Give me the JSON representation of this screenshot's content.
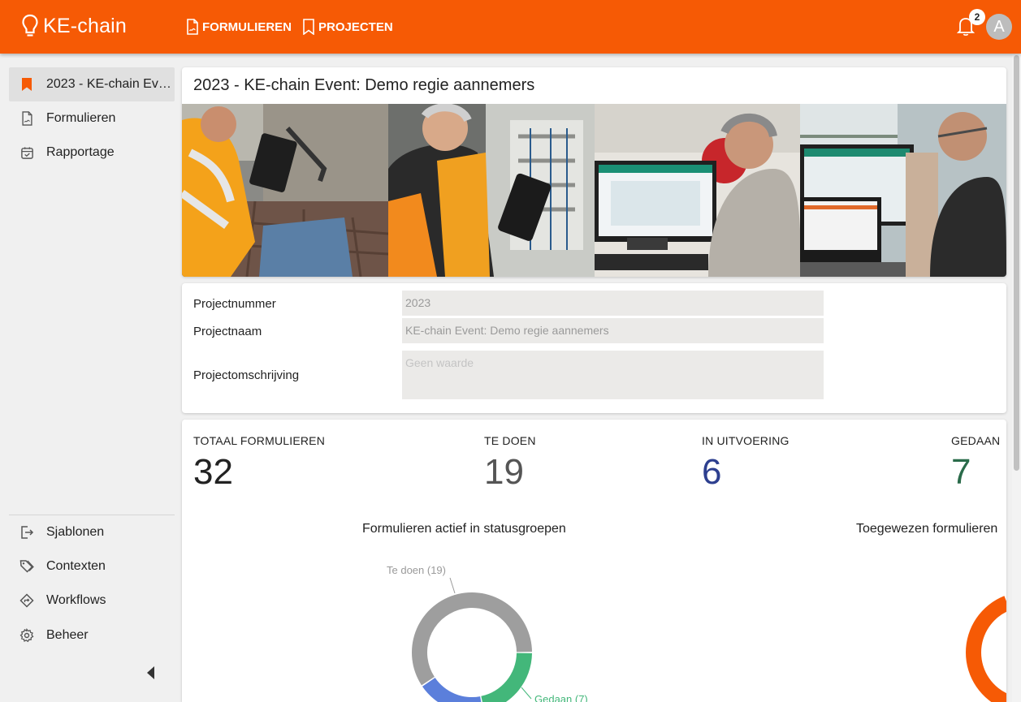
{
  "header": {
    "logo_text": "KE-chain",
    "nav": [
      {
        "label": "FORMULIEREN"
      },
      {
        "label": "PROJECTEN"
      }
    ],
    "notification_count": "2",
    "avatar_initial": "A"
  },
  "sidebar": {
    "top_items": [
      {
        "label": "2023 - KE-chain Event: Demo regie aannemers",
        "icon": "bookmark-icon",
        "active": true
      },
      {
        "label": "Formulieren",
        "icon": "form-icon"
      },
      {
        "label": "Rapportage",
        "icon": "report-icon"
      }
    ],
    "bottom_items": [
      {
        "label": "Sjablonen",
        "icon": "template-icon"
      },
      {
        "label": "Contexten",
        "icon": "tags-icon"
      },
      {
        "label": "Workflows",
        "icon": "workflow-icon"
      },
      {
        "label": "Beheer",
        "icon": "gear-icon"
      }
    ]
  },
  "project": {
    "title": "2023 - KE-chain Event: Demo regie aannemers",
    "properties": [
      {
        "label": "Projectnummer",
        "value": "2023"
      },
      {
        "label": "Projectnaam",
        "value": "KE-chain Event: Demo regie aannemers"
      },
      {
        "label": "Projectomschrijving",
        "value": "Geen waarde"
      }
    ]
  },
  "stats": [
    {
      "label": "TOTAAL FORMULIEREN",
      "value": "32",
      "color": "#222222"
    },
    {
      "label": "TE DOEN",
      "value": "19",
      "color": "#555555"
    },
    {
      "label": "IN UITVOERING",
      "value": "6",
      "color": "#2d3f8f"
    },
    {
      "label": "GEDAAN",
      "value": "7",
      "color": "#2a6b4a"
    }
  ],
  "chart_data": [
    {
      "type": "pie",
      "title": "Formulieren actief in statusgroepen",
      "categories": [
        "Te doen",
        "Gedaan",
        "In uitvoering"
      ],
      "values": [
        19,
        7,
        6
      ],
      "labels": [
        "Te doen (19)",
        "Gedaan (7)"
      ],
      "colors": [
        "#9e9e9e",
        "#43b77a",
        "#5b7fdb"
      ]
    },
    {
      "type": "pie",
      "title": "Toegewezen formulieren",
      "colors": [
        "#f65a05",
        "#a5a5a5"
      ]
    }
  ]
}
